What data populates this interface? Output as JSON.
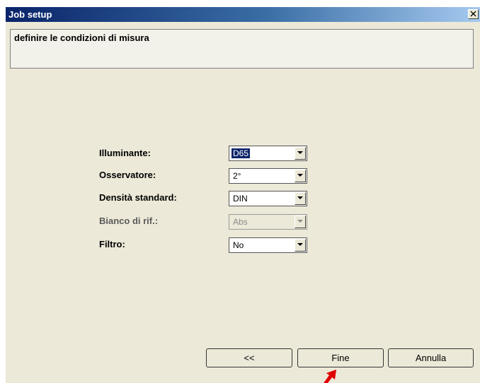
{
  "window": {
    "title": "Job setup",
    "close_icon": "close-icon"
  },
  "description": {
    "text": "definire le condizioni di misura"
  },
  "fields": [
    {
      "label": "Illuminante:",
      "value": "D65",
      "selected": true,
      "disabled": false
    },
    {
      "label": "Osservatore:",
      "value": "2°",
      "selected": false,
      "disabled": false
    },
    {
      "label": "Densità standard:",
      "value": "DIN",
      "selected": false,
      "disabled": false
    },
    {
      "label": "Bianco di rif.:",
      "value": "Abs",
      "selected": false,
      "disabled": true
    },
    {
      "label": "Filtro:",
      "value": "No",
      "selected": false,
      "disabled": false
    }
  ],
  "buttons": {
    "back_label": "<<",
    "finish_label": "Fine",
    "cancel_label": "Annulla"
  },
  "annotation": {
    "pointer_icon": "red-arrow-icon",
    "color": "#e00000"
  }
}
